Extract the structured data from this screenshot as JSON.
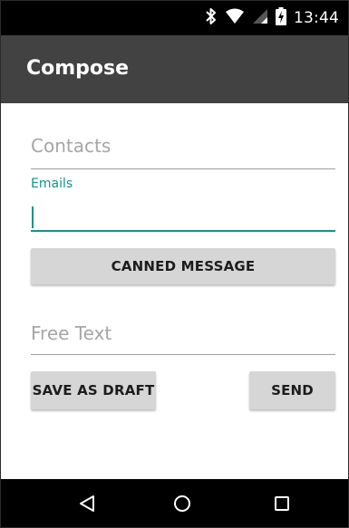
{
  "status_bar": {
    "time": "13:44",
    "icons": [
      "bluetooth-icon",
      "wifi-icon",
      "signal-icon",
      "battery-icon"
    ]
  },
  "app_bar": {
    "title": "Compose"
  },
  "form": {
    "contacts_placeholder": "Contacts",
    "emails_label": "Emails",
    "emails_value": "",
    "canned_message_label": "CANNED MESSAGE",
    "free_text_placeholder": "Free Text",
    "save_draft_label": "SAVE AS DRAFT",
    "send_label": "SEND"
  },
  "nav_bar": {
    "icons": [
      "back-icon",
      "home-icon",
      "recents-icon"
    ]
  },
  "colors": {
    "accent": "#15938a",
    "app_bar": "#424242",
    "button": "#d6d6d6"
  }
}
